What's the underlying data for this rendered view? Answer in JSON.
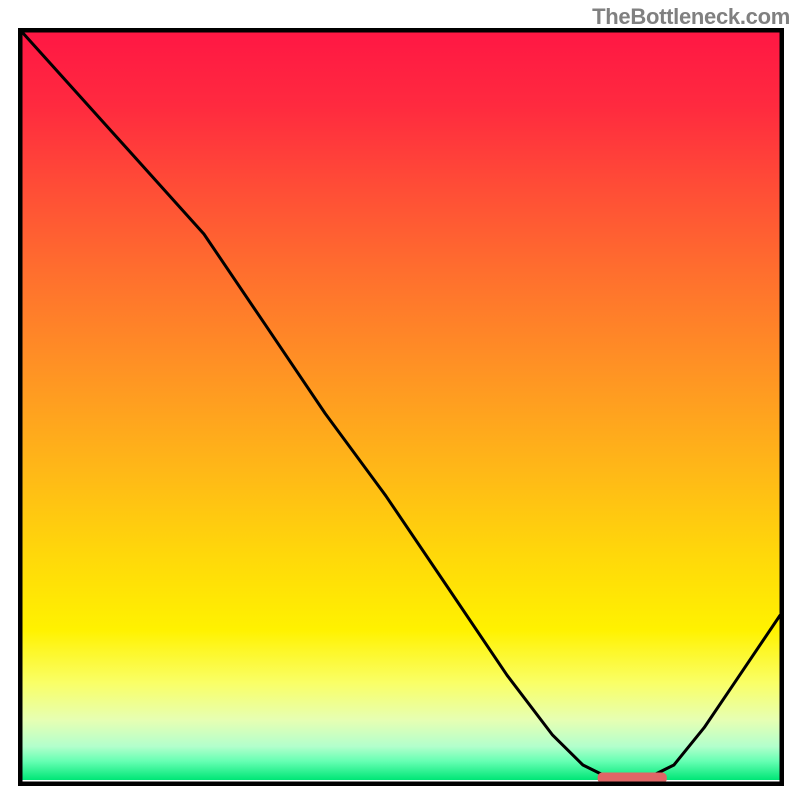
{
  "watermark": "TheBottleneck.com",
  "colors": {
    "frame": "#000000",
    "curve": "#000000",
    "marker_fill": "#e06666",
    "marker_stroke": "#e06666",
    "gradient_stops": [
      {
        "offset": 0.0,
        "color": "#ff1744"
      },
      {
        "offset": 0.1,
        "color": "#ff2a3f"
      },
      {
        "offset": 0.2,
        "color": "#ff4a37"
      },
      {
        "offset": 0.32,
        "color": "#ff6e2e"
      },
      {
        "offset": 0.45,
        "color": "#ff9224"
      },
      {
        "offset": 0.58,
        "color": "#ffb618"
      },
      {
        "offset": 0.7,
        "color": "#ffd80a"
      },
      {
        "offset": 0.8,
        "color": "#fff200"
      },
      {
        "offset": 0.87,
        "color": "#faff66"
      },
      {
        "offset": 0.92,
        "color": "#e6ffb3"
      },
      {
        "offset": 0.955,
        "color": "#b3ffcc"
      },
      {
        "offset": 0.975,
        "color": "#66ffb3"
      },
      {
        "offset": 1.0,
        "color": "#00e676"
      }
    ]
  },
  "chart_data": {
    "type": "line",
    "title": "",
    "xlabel": "",
    "ylabel": "",
    "xlim": [
      0,
      100
    ],
    "ylim": [
      0,
      100
    ],
    "x": [
      0,
      8,
      16,
      24,
      32,
      40,
      48,
      56,
      64,
      70,
      74,
      78,
      82,
      86,
      90,
      94,
      100
    ],
    "values": [
      100,
      91,
      82,
      73,
      61,
      49,
      38,
      26,
      14,
      6,
      2,
      0,
      0,
      2,
      7,
      13,
      22
    ],
    "marker": {
      "x_start": 76,
      "x_end": 85,
      "y": 0
    },
    "annotations": []
  }
}
